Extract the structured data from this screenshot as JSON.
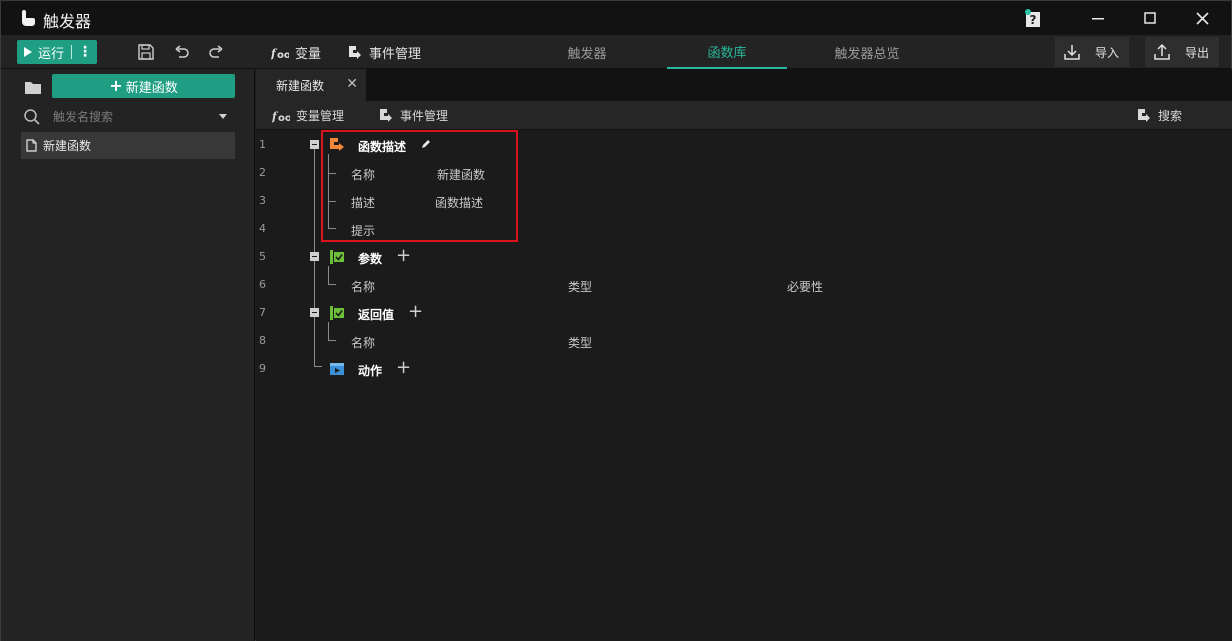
{
  "app": {
    "title": "触发器"
  },
  "toolbar": {
    "run_label": "运行",
    "variables_label": "变量",
    "events_label": "事件管理",
    "tabs": [
      {
        "label": "触发器",
        "active": false
      },
      {
        "label": "函数库",
        "active": true
      },
      {
        "label": "触发器总览",
        "active": false
      }
    ],
    "import_label": "导入",
    "export_label": "导出",
    "accent_color": "#28b79c"
  },
  "sidebar": {
    "new_function_label": "新建函数",
    "search": {
      "placeholder": "触发名搜索",
      "value": ""
    },
    "items": [
      {
        "label": "新建函数"
      }
    ]
  },
  "editor": {
    "open_tab": {
      "label": "新建函数",
      "close": "✕"
    },
    "sub_toolbar": {
      "variables_label": "变量管理",
      "events_label": "事件管理",
      "search_label": "搜索"
    },
    "tree": {
      "line_numbers": [
        "1",
        "2",
        "3",
        "4",
        "5",
        "6",
        "7",
        "8",
        "9"
      ],
      "description": {
        "header": "函数描述",
        "name_label": "名称",
        "name_value": "新建函数",
        "desc_label": "描述",
        "desc_value": "函数描述",
        "hint_label": "提示"
      },
      "params": {
        "header": "参数",
        "col_name": "名称",
        "col_type": "类型",
        "col_required": "必要性"
      },
      "returns": {
        "header": "返回值",
        "col_name": "名称",
        "col_type": "类型"
      },
      "actions": {
        "header": "动作"
      }
    }
  }
}
